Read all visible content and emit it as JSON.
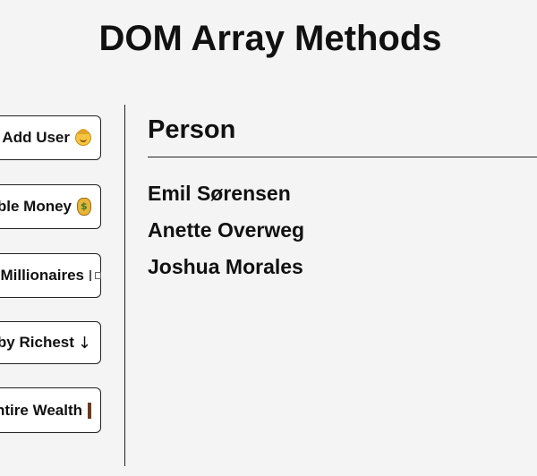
{
  "page": {
    "title": "DOM Array Methods"
  },
  "sidebar": {
    "buttons": [
      {
        "label": "Add User",
        "icon": "baby-face-icon"
      },
      {
        "label": "Double Money",
        "icon": "money-bag-icon"
      },
      {
        "label": "Show Only Millionaires",
        "icon": "dollar-bill-icon"
      },
      {
        "label": "Sort by Richest",
        "icon": "down-arrow-icon",
        "glyph": "↓"
      },
      {
        "label": "Calculate entire Wealth",
        "icon": "abacus-icon"
      }
    ]
  },
  "main": {
    "header": "Person",
    "people": [
      {
        "name": "Emil Sørensen"
      },
      {
        "name": "Anette Overweg"
      },
      {
        "name": "Joshua Morales"
      }
    ]
  },
  "colors": {
    "background": "#f4f4f4",
    "button_bg": "#ffffff",
    "border": "#222222",
    "text": "#111111"
  }
}
